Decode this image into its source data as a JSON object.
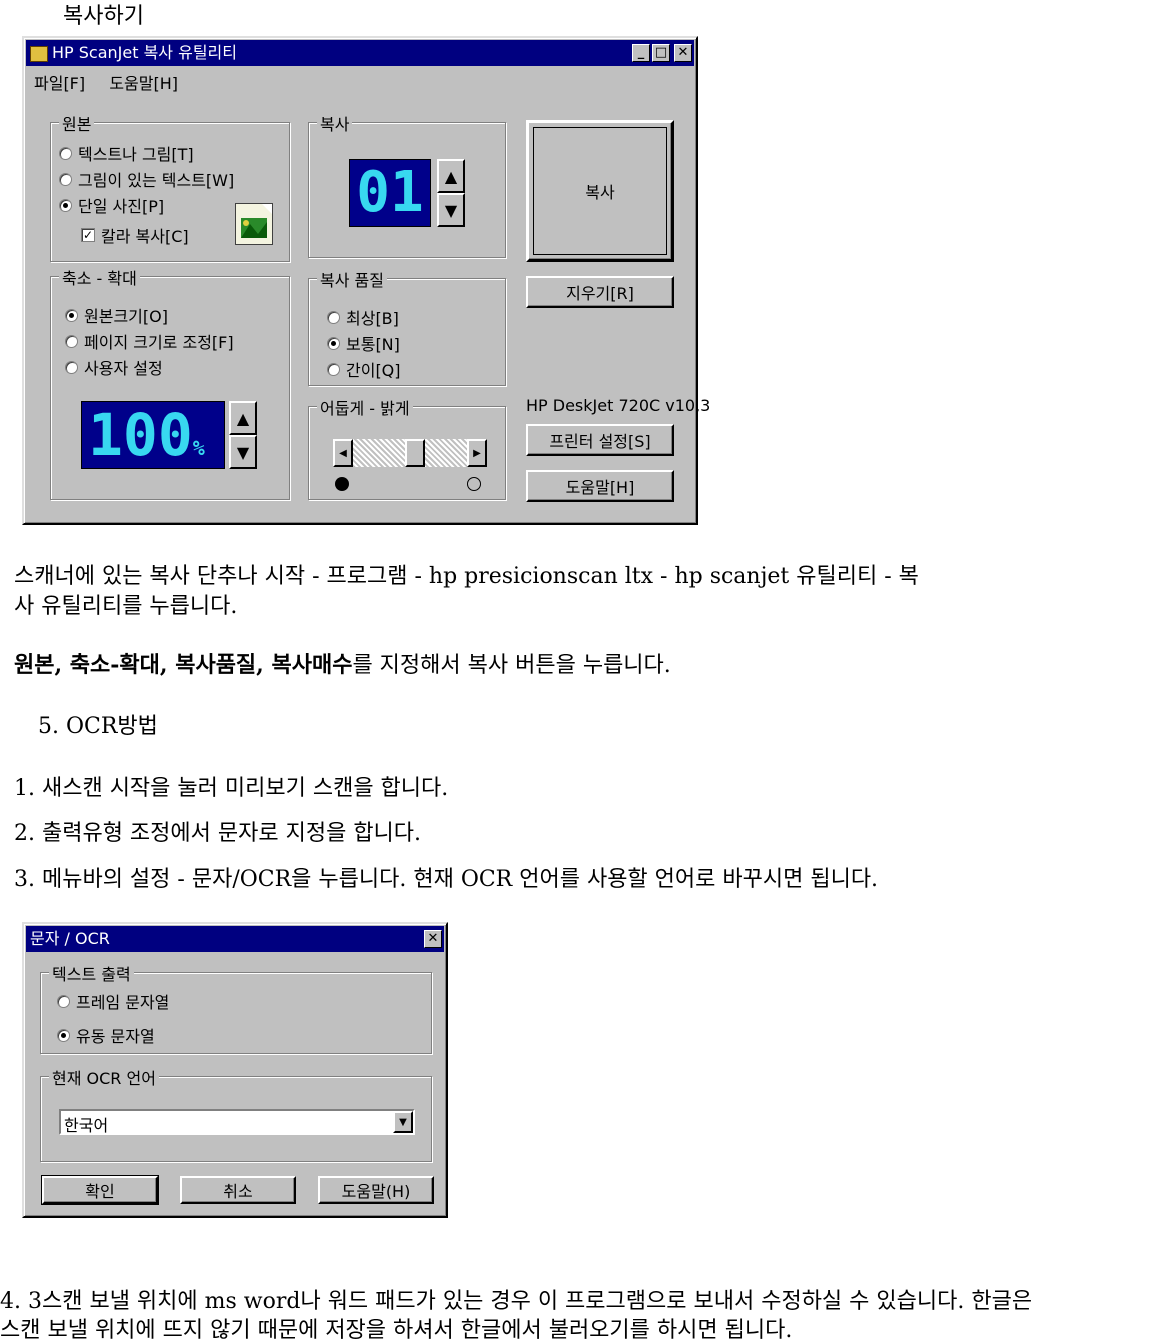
{
  "heading": "복사하기",
  "copy_window": {
    "title": "HP ScanJet 복사 유틸리티",
    "menu": [
      "파일[F]",
      "도움말[H]"
    ],
    "original_group": {
      "label": "원본",
      "options": [
        "텍스트나 그림[T]",
        "그림이 있는 텍스트[W]",
        "단일 사진[P]"
      ],
      "selected_index": 2,
      "color_copy_label": "칼라 복사[C]",
      "color_copy_checked": true
    },
    "copies_group": {
      "label": "복사",
      "count_display": "01"
    },
    "copy_button": "복사",
    "clear_button": "지우기[R]",
    "scale_group": {
      "label": "축소 - 확대",
      "options": [
        "원본크기[O]",
        "페이지 크기로 조정[F]",
        "사용자 설정"
      ],
      "selected_index": 0,
      "value_display": "100",
      "unit": "%"
    },
    "quality_group": {
      "label": "복사 품질",
      "options": [
        "최상[B]",
        "보통[N]",
        "간이[Q]"
      ],
      "selected_index": 1
    },
    "brightness_group": {
      "label": "어둡게 - 밝게",
      "level": 0.55
    },
    "printer_label": "HP DeskJet 720C v10,3",
    "printer_settings_button": "프린터 설정[S]",
    "help_button": "도움말[H]"
  },
  "paragraph1_line1": "스캐너에 있는 복사 단추나 시작 - 프로그램 - hp presicionscan ltx - hp scanjet 유틸리티 - 복",
  "paragraph1_line2": "사 유틸리티를 누릅니다.",
  "paragraph2_bold": "원본, 축소-확대, 복사품질, 복사매수",
  "paragraph2_rest": "를 지정해서 복사 버튼을 누릅니다.",
  "section_heading": "5. OCR방법",
  "steps": [
    "1. 새스캔 시작을 눌러 미리보기 스캔을 합니다.",
    "2. 출력유형 조정에서 문자로 지정을 합니다.",
    "3. 메뉴바의 설정 - 문자/OCR을 누릅니다. 현재 OCR 언어를 사용할 언어로 바꾸시면 됩니다."
  ],
  "ocr_dialog": {
    "title": "문자 / OCR",
    "text_output_group": {
      "label": "텍스트 출력",
      "options": [
        "프레임 문자열",
        "유동 문자열"
      ],
      "selected_index": 1
    },
    "language_group": {
      "label": "현재 OCR 언어",
      "selected_language": "한국어"
    },
    "ok_button": "확인",
    "cancel_button": "취소",
    "help_button": "도움말(H)"
  },
  "paragraph4_line1": "4. 3스캔 보낼 위치에 ms word나 워드 패드가 있는 경우 이 프로그램으로 보내서 수정하실 수 있습니다. 한글은",
  "paragraph4_line2": "스캔 보낼 위치에 뜨지 않기 때문에 저장을 하셔서 한글에서 불러오기를 하시면 됩니다."
}
